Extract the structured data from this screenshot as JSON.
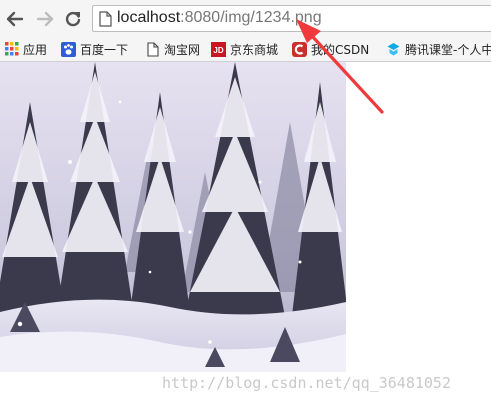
{
  "browser": {
    "address_bar": {
      "host": "localhost",
      "path": ":8080/img/1234.png"
    }
  },
  "bookmarks": {
    "items": [
      {
        "label": "应用",
        "icon": "apps-grid-icon"
      },
      {
        "label": "百度一下",
        "icon": "baidu-paw-icon"
      },
      {
        "label": "淘宝网",
        "icon": "page-icon"
      },
      {
        "label": "京东商城",
        "icon": "jd-logo-icon"
      },
      {
        "label": "我的CSDN",
        "icon": "csdn-logo-icon"
      },
      {
        "label": "腾讯课堂-个人中",
        "icon": "tencent-classroom-icon"
      }
    ]
  },
  "content": {
    "image": "snowy-forest-image"
  },
  "watermark": {
    "text": "http://blog.csdn.net/qq_36481052"
  },
  "annotation": {
    "color": "#f0393a"
  }
}
